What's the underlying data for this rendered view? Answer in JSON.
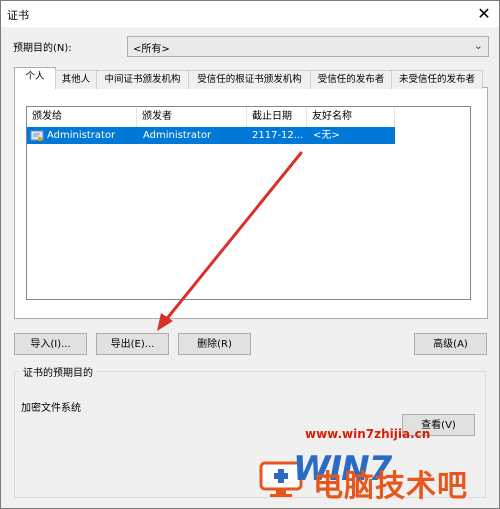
{
  "window": {
    "title": "证书",
    "close_glyph": "✕"
  },
  "purpose": {
    "label": "预期目的(N):",
    "value": "<所有>",
    "arrow": "⌄"
  },
  "tabs": [
    {
      "label": "个人",
      "active": true
    },
    {
      "label": "其他人",
      "active": false
    },
    {
      "label": "中间证书颁发机构",
      "active": false
    },
    {
      "label": "受信任的根证书颁发机构",
      "active": false
    },
    {
      "label": "受信任的发布者",
      "active": false
    },
    {
      "label": "未受信任的发布者",
      "active": false
    }
  ],
  "table": {
    "columns": [
      "颁发给",
      "颁发者",
      "截止日期",
      "友好名称"
    ],
    "rows": [
      {
        "issued_to": "Administrator",
        "issuer": "Administrator",
        "expiry": "2117-12...",
        "friendly": "<无>",
        "selected": true
      }
    ]
  },
  "buttons": {
    "import": "导入(I)...",
    "export": "导出(E)...",
    "remove": "删除(R)",
    "advanced": "高级(A)",
    "view": "查看(V)"
  },
  "purposes_group": {
    "title": "证书的预期目的",
    "value": "加密文件系统"
  },
  "watermark": {
    "url": "www.win7zhijia.cn",
    "logo": "WIN7",
    "text": "电脑技术吧"
  },
  "colors": {
    "selection": "#0078d7",
    "arrow": "#d9302a",
    "watermark_red": "#d81e06"
  }
}
